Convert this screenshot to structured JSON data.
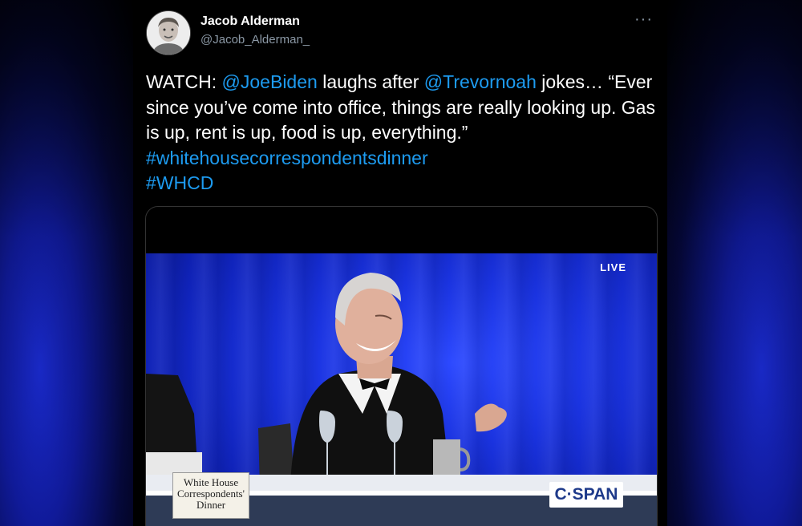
{
  "tweet": {
    "author_name": "Jacob Alderman",
    "author_handle": "@Jacob_Alderman_",
    "more_icon": "ellipsis-icon",
    "text": {
      "p1": "WATCH: ",
      "mention1": "@JoeBiden",
      "p2": " laughs after ",
      "mention2": "@Trevornoah",
      "p3": " jokes… “Ever since you’ve come into office, things are really looking up. Gas is up, rent is up, food is up, everything.” ",
      "hashtag1": "#whitehousecorrespondentsdinner",
      "hashtag2": "#WHCD"
    }
  },
  "media": {
    "live_label": "LIVE",
    "event_logo_line1": "White House",
    "event_logo_line2": "Correspondents'",
    "event_logo_line3": "Dinner",
    "network_logo": "C·SPAN"
  },
  "colors": {
    "link": "#1d9bf0",
    "background": "#000000",
    "secondary_text": "#8b98a5",
    "stage_blue": "#1a33e0"
  }
}
